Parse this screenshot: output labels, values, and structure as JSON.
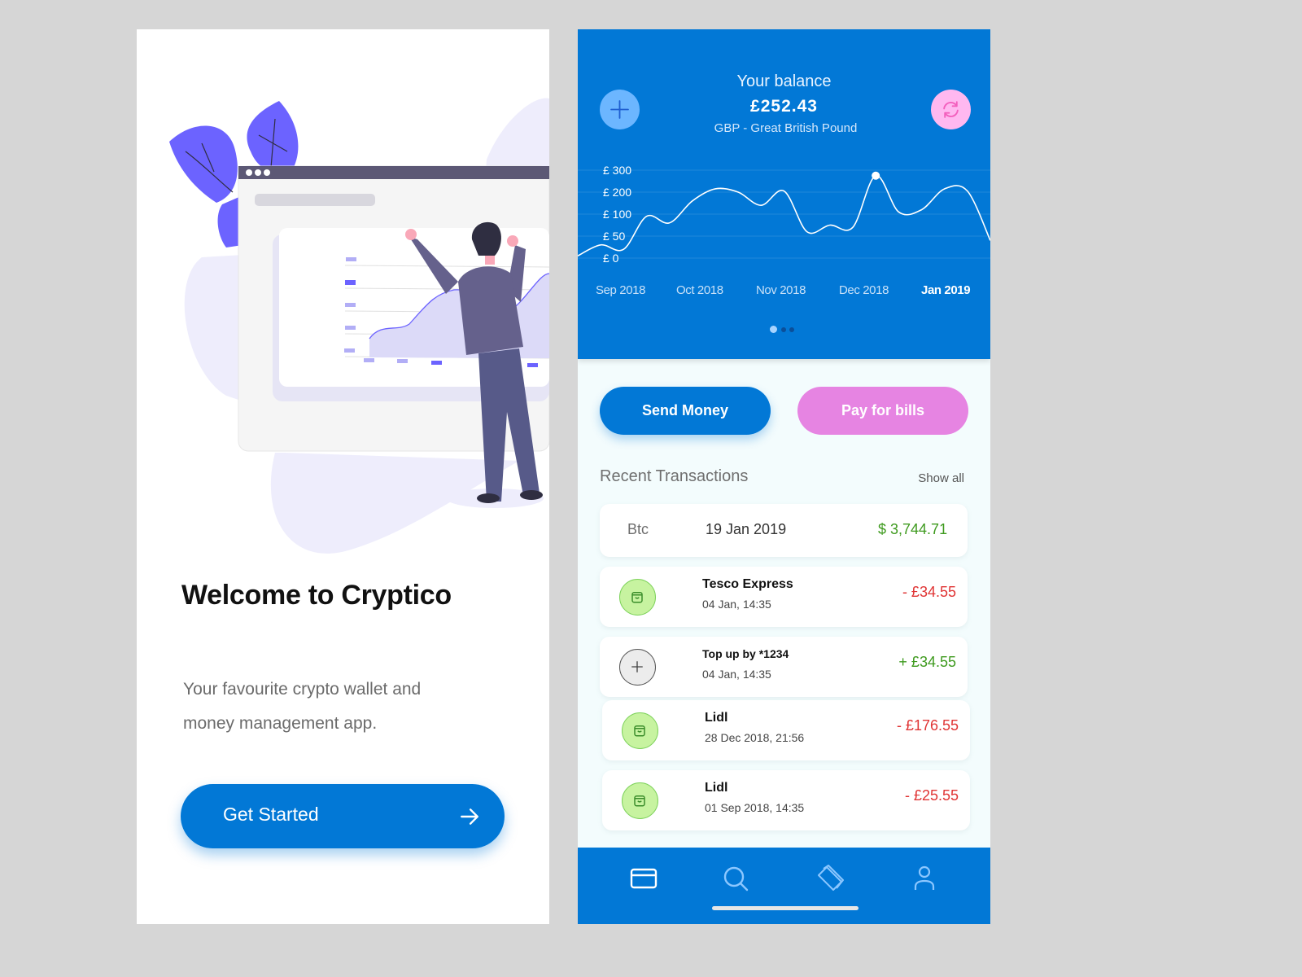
{
  "welcome_screen": {
    "title": "Welcome to Cryptico",
    "subtitle_line1": "Your favourite crypto wallet and",
    "subtitle_line2": "money management app.",
    "cta_label": "Get Started",
    "cta_icon": "arrow-right-icon",
    "illustration": "man-analyzing-chart-illustration",
    "accent_color": "#0278d6"
  },
  "dashboard": {
    "balance_label": "Your balance",
    "balance_value": "£252.43",
    "currency": "GBP - Great British Pound",
    "add_button_icon": "plus-icon",
    "refresh_button_icon": "refresh-icon",
    "pager": {
      "count": 3,
      "active_index": 0
    },
    "actions": {
      "send_money": "Send Money",
      "pay_bills": "Pay for bills"
    },
    "recent_title": "Recent Transactions",
    "show_all": "Show all",
    "highlight": {
      "asset": "Btc",
      "date": "19 Jan 2019",
      "amount": "$ 3,744.71"
    },
    "transactions": [
      {
        "icon": "shopping-bag-icon",
        "name": "Tesco Express",
        "time": "04 Jan, 14:35",
        "amount": "- £34.55",
        "type": "debit"
      },
      {
        "icon": "plus-icon",
        "name": "Top up by *1234",
        "time": "04 Jan, 14:35",
        "amount": "+ £34.55",
        "type": "credit"
      },
      {
        "icon": "shopping-bag-icon",
        "name": "Lidl",
        "time": "28 Dec 2018, 21:56",
        "amount": "- £176.55",
        "type": "debit"
      },
      {
        "icon": "shopping-bag-icon",
        "name": "Lidl",
        "time": "01 Sep 2018, 14:35",
        "amount": "- £25.55",
        "type": "debit"
      }
    ],
    "tabbar": [
      {
        "name": "cards",
        "icon": "card-icon",
        "active": true
      },
      {
        "name": "search",
        "icon": "search-icon",
        "active": false
      },
      {
        "name": "wallets",
        "icon": "tickets-icon",
        "active": false
      },
      {
        "name": "profile",
        "icon": "user-icon",
        "active": false
      }
    ],
    "colors": {
      "primary": "#0278d6",
      "pink": "#e684e2",
      "positive": "#3e9a1e",
      "negative": "#e03434"
    }
  },
  "chart_data": {
    "type": "line",
    "title": "",
    "xlabel": "",
    "ylabel": "",
    "y_tick_labels": [
      "£ 300",
      "£ 200",
      "£ 100",
      "£ 50",
      "£ 0"
    ],
    "y_ticks": [
      300,
      200,
      100,
      50,
      0
    ],
    "categories": [
      "Sep 2018",
      "Oct 2018",
      "Nov 2018",
      "Dec 2018",
      "Jan 2019"
    ],
    "active_category": "Jan 2019",
    "grid": true,
    "x": [
      0,
      0.25,
      0.5,
      0.75,
      1.0,
      1.25,
      1.5,
      1.75,
      2.0,
      2.25,
      2.5,
      2.75,
      3.0,
      3.25,
      3.5,
      3.75,
      4.0,
      4.25,
      4.5
    ],
    "note": "x is continuous months from Sep 2018 (0) to Jan 2019 (4); values in £ on a non-linear scale",
    "series": [
      {
        "name": "Balance",
        "values": [
          5,
          30,
          20,
          95,
          80,
          160,
          215,
          200,
          140,
          205,
          60,
          75,
          70,
          275,
          110,
          120,
          215,
          205,
          40
        ]
      }
    ],
    "highlighted_point": {
      "x": 3.25,
      "y": 275
    }
  }
}
